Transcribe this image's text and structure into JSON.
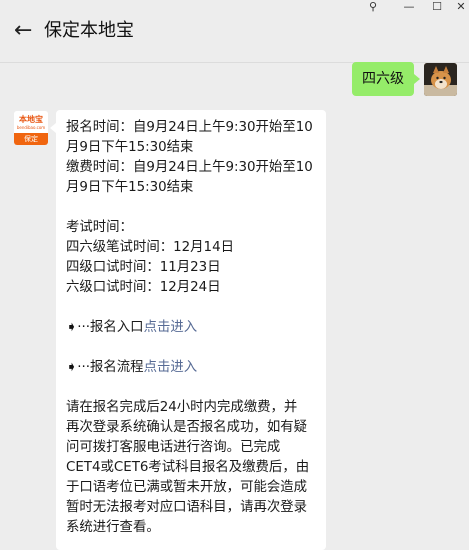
{
  "window": {
    "pin_icon": "pin-icon",
    "minimize_label": "—",
    "maximize_label": "☐",
    "close_label": "✕"
  },
  "header": {
    "back_label": "←",
    "title": "保定本地宝"
  },
  "user_message": {
    "text": "四六级"
  },
  "bot": {
    "logo_text": "本地宝",
    "logo_url": "bendibao.com",
    "logo_city": "保定"
  },
  "bot_message": {
    "reg_time_line1": "报名时间：自9月24日上午9:30开始至10",
    "reg_time_line2": "月9日下午15:30结束",
    "pay_time_line1": "缴费时间：自9月24日上午9:30开始至10",
    "pay_time_line2": "月9日下午15:30结束",
    "exam_time_heading": "考试时间：",
    "written_exam": "四六级笔试时间：12月14日",
    "cet4_oral": "四级口试时间：11月23日",
    "cet6_oral": "六级口试时间：12月24日",
    "arrow_glyph": "➧···",
    "reg_entry_label": "报名入口",
    "reg_entry_link": "点击进入",
    "reg_flow_label": "报名流程",
    "reg_flow_link": "点击进入",
    "notice_line1": "请在报名完成后24小时内完成缴费，并",
    "notice_line2": "再次登录系统确认是否报名成功，如有疑",
    "notice_line3": "问可拨打客服电话进行咨询。已完成",
    "notice_line4": "CET4或CET6考试科目报名及缴费后，由",
    "notice_line5": "于口语考位已满或暂未开放，可能会造成",
    "notice_line6": "暂时无法报考对应口语科目，请再次登录",
    "notice_line7": "系统进行查看。"
  },
  "colors": {
    "background": "#ededed",
    "user_bubble": "#95ec69",
    "bot_bubble": "#ffffff",
    "link": "#576b95",
    "brand_orange": "#f0650f"
  }
}
